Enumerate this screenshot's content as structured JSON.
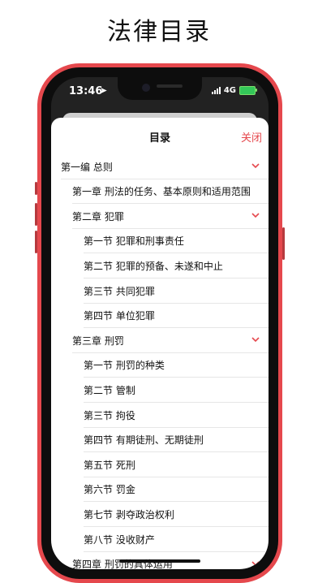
{
  "promo": {
    "title": "法律目录"
  },
  "status": {
    "time": "13:46",
    "network": "4G"
  },
  "sheet": {
    "title": "目录",
    "close_label": "关闭"
  },
  "toc": [
    {
      "label": "第一编 总则",
      "level": 0,
      "chevron": true
    },
    {
      "label": "第一章 刑法的任务、基本原则和适用范围",
      "level": 1,
      "chevron": false
    },
    {
      "label": "第二章 犯罪",
      "level": 1,
      "chevron": true
    },
    {
      "label": "第一节 犯罪和刑事责任",
      "level": 2,
      "chevron": false
    },
    {
      "label": "第二节 犯罪的预备、未遂和中止",
      "level": 2,
      "chevron": false
    },
    {
      "label": "第三节 共同犯罪",
      "level": 2,
      "chevron": false
    },
    {
      "label": "第四节 单位犯罪",
      "level": 2,
      "chevron": false
    },
    {
      "label": "第三章 刑罚",
      "level": 1,
      "chevron": true
    },
    {
      "label": "第一节 刑罚的种类",
      "level": 2,
      "chevron": false
    },
    {
      "label": "第二节 管制",
      "level": 2,
      "chevron": false
    },
    {
      "label": "第三节 拘役",
      "level": 2,
      "chevron": false
    },
    {
      "label": "第四节 有期徒刑、无期徒刑",
      "level": 2,
      "chevron": false
    },
    {
      "label": "第五节 死刑",
      "level": 2,
      "chevron": false
    },
    {
      "label": "第六节 罚金",
      "level": 2,
      "chevron": false
    },
    {
      "label": "第七节 剥夺政治权利",
      "level": 2,
      "chevron": false
    },
    {
      "label": "第八节 没收财产",
      "level": 2,
      "chevron": false
    },
    {
      "label": "第四章 刑罚的具体运用",
      "level": 1,
      "chevron": true
    }
  ],
  "colors": {
    "accent": "#e5484d",
    "frame": "#e5484d",
    "divider": "#e6e6e6"
  },
  "icons": {
    "chevron": "chevron-down-icon",
    "location": "location-arrow-icon"
  }
}
